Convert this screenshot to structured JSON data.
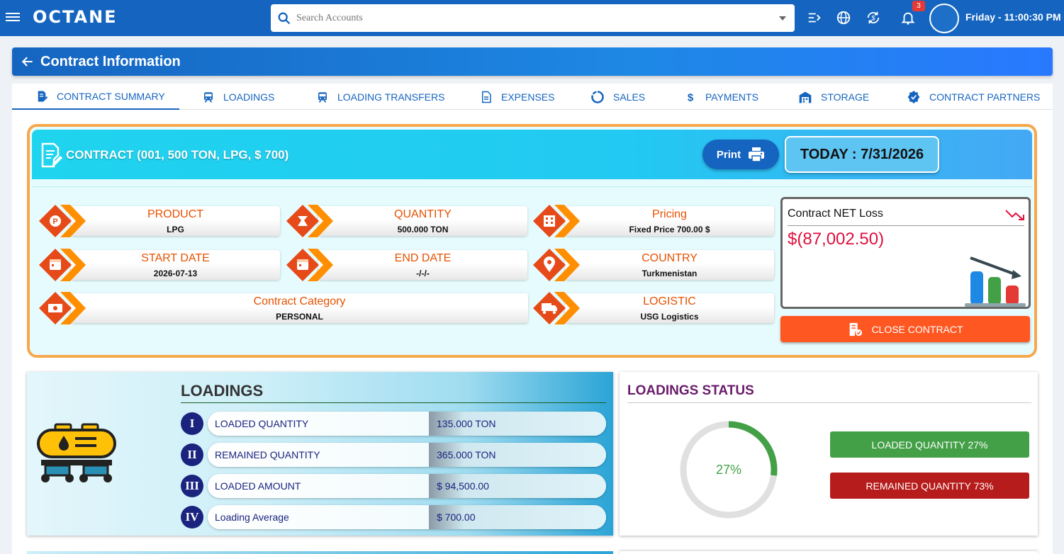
{
  "header": {
    "logo": "OCTANE",
    "search_placeholder": "Search Accounts",
    "notifications_count": "3",
    "clock": "Friday - 11:00:30 PM"
  },
  "page": {
    "title": "Contract Information"
  },
  "tabs": [
    {
      "label": "CONTRACT SUMMARY",
      "icon": "edit-document-icon",
      "active": true
    },
    {
      "label": "LOADINGS",
      "icon": "train-icon"
    },
    {
      "label": "LOADING TRANSFERS",
      "icon": "train-icon"
    },
    {
      "label": "EXPENSES",
      "icon": "document-icon"
    },
    {
      "label": "SALES",
      "icon": "circle-progress-icon"
    },
    {
      "label": "PAYMENTS",
      "icon": "dollar-icon"
    },
    {
      "label": "STORAGE",
      "icon": "warehouse-icon"
    },
    {
      "label": "CONTRACT PARTNERS",
      "icon": "verified-badge-icon"
    }
  ],
  "contract": {
    "heading": "CONTRACT (001, 500 TON, LPG, $ 700)",
    "print_label": "Print",
    "today": "TODAY : 7/31/2026",
    "fields": {
      "product": {
        "label": "PRODUCT",
        "value": "LPG"
      },
      "quantity": {
        "label": "QUANTITY",
        "value": "500.000 TON"
      },
      "pricing": {
        "label": "Pricing",
        "value": "Fixed Price 700.00 $"
      },
      "start_date": {
        "label": "START DATE",
        "value": "2026-07-13"
      },
      "end_date": {
        "label": "END DATE",
        "value": "-/-/-"
      },
      "country": {
        "label": "COUNTRY",
        "value": "Turkmenistan"
      },
      "category": {
        "label": "Contract Category",
        "value": "PERSONAL"
      },
      "logistic": {
        "label": "LOGISTIC",
        "value": "USG Logistics"
      }
    },
    "net": {
      "title": "Contract NET Loss",
      "value": "$(87,002.50)"
    },
    "close_label": "CLOSE CONTRACT"
  },
  "loadings": {
    "title": "LOADINGS",
    "rows": [
      {
        "num": "I",
        "label": "LOADED QUANTITY",
        "value": "135.000 TON"
      },
      {
        "num": "II",
        "label": "REMAINED QUANTITY",
        "value": "365.000 TON"
      },
      {
        "num": "III",
        "label": "LOADED AMOUNT",
        "value": "$ 94,500.00"
      },
      {
        "num": "IV",
        "label": "Loading Average",
        "value": "$ 700.00"
      }
    ]
  },
  "status": {
    "title": "LOADINGS STATUS",
    "percent_label": "27%",
    "loaded_fraction": 0.27,
    "loaded_label": "LOADED QUANTITY 27%",
    "remained_label": "REMAINED QUANTITY 73%",
    "colors": {
      "loaded": "#43a047",
      "remained": "#b71c1c",
      "track": "#e0e0e0"
    }
  }
}
